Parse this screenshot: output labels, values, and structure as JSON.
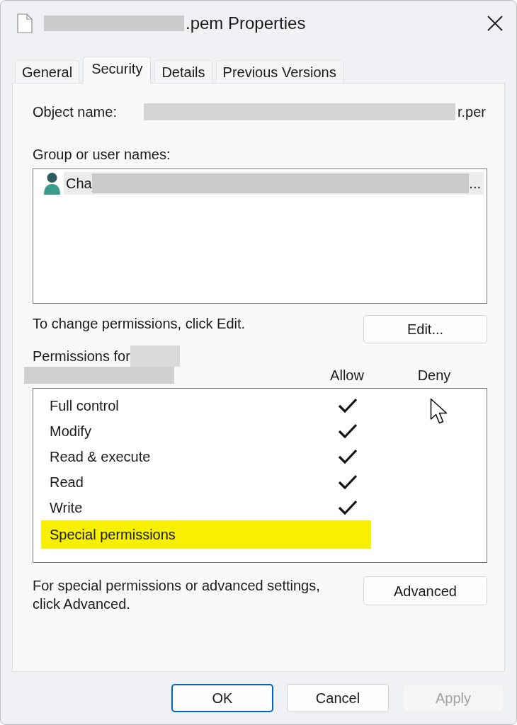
{
  "window": {
    "title": ".pem Properties",
    "title_redacted": true
  },
  "tabs": [
    {
      "label": "General",
      "selected": false
    },
    {
      "label": "Security",
      "selected": true
    },
    {
      "label": "Details",
      "selected": false
    },
    {
      "label": "Previous Versions",
      "selected": false
    }
  ],
  "object_name": {
    "label": "Object name:",
    "value": "r.per",
    "redacted": true
  },
  "group_or_user_names": {
    "label": "Group or user names:",
    "items": [
      {
        "name": "Cha",
        "ellipsis": "...",
        "redacted": true,
        "selected": true
      }
    ]
  },
  "edit_hint": "To change permissions, click Edit.",
  "edit_button": "Edit...",
  "permissions": {
    "label": "Permissions for",
    "redacted": true,
    "columns": [
      "Allow",
      "Deny"
    ],
    "rows": [
      {
        "name": "Full control",
        "allow": true,
        "deny": false,
        "highlighted": false
      },
      {
        "name": "Modify",
        "allow": true,
        "deny": false,
        "highlighted": false
      },
      {
        "name": "Read & execute",
        "allow": true,
        "deny": false,
        "highlighted": false
      },
      {
        "name": "Read",
        "allow": true,
        "deny": false,
        "highlighted": false
      },
      {
        "name": "Write",
        "allow": true,
        "deny": false,
        "highlighted": false
      },
      {
        "name": "Special permissions",
        "allow": false,
        "deny": false,
        "highlighted": true
      }
    ]
  },
  "advanced_hint": "For special permissions or advanced settings, click Advanced.",
  "advanced_button": "Advanced",
  "buttons": [
    {
      "label": "OK",
      "default": true,
      "disabled": false
    },
    {
      "label": "Cancel",
      "default": false,
      "disabled": false
    },
    {
      "label": "Apply",
      "default": false,
      "disabled": true
    }
  ]
}
